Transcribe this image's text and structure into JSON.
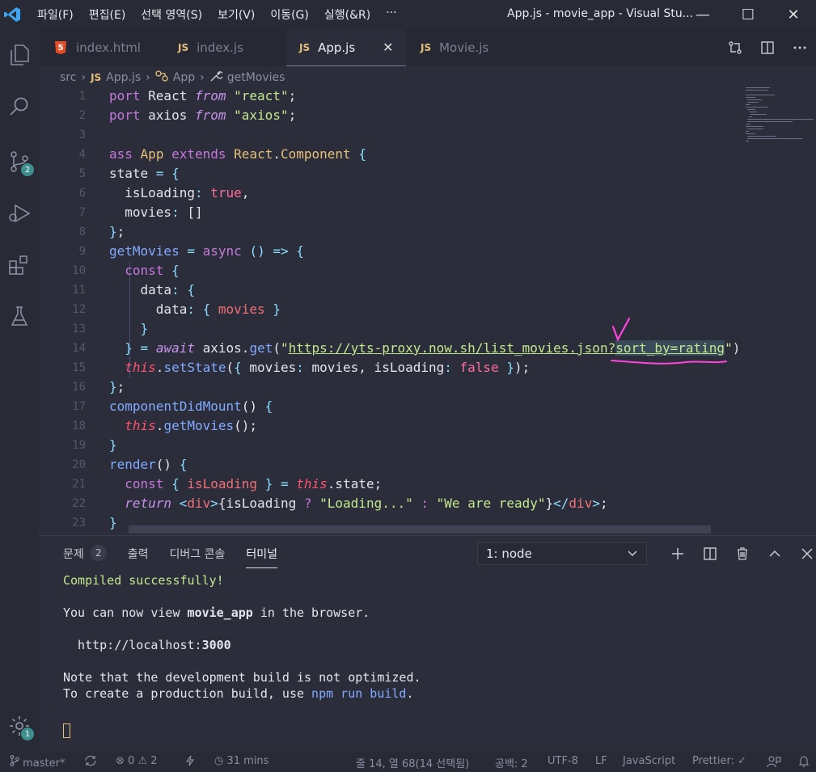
{
  "window": {
    "title": "App.js - movie_app - Visual Stu...",
    "menu": [
      "파일(F)",
      "편집(E)",
      "선택 영역(S)",
      "보기(V)",
      "이동(G)",
      "실행(&R)",
      "···"
    ],
    "controls": {
      "minimize": "—",
      "maximize": "☐",
      "close": "✕"
    }
  },
  "activity_bar": {
    "scm_badge": "2",
    "settings_badge": "1"
  },
  "tabs": [
    {
      "label": "index.html",
      "icon": "html5-icon",
      "icon_text": "5"
    },
    {
      "label": "index.js",
      "icon": "js-icon",
      "icon_text": "JS"
    },
    {
      "label": "App.js",
      "icon": "js-icon",
      "icon_text": "JS",
      "active": true,
      "close": "✕"
    },
    {
      "label": "Movie.js",
      "icon": "js-icon",
      "icon_text": "JS"
    }
  ],
  "breadcrumb": {
    "folder": "src",
    "file_icon": "JS",
    "file": "App.js",
    "class": "App",
    "method": "getMovies"
  },
  "editor": {
    "lines": [
      {
        "n": "1",
        "code": "port React from \"react\";"
      },
      {
        "n": "2",
        "code": "port axios from \"axios\";"
      },
      {
        "n": "3",
        "code": ""
      },
      {
        "n": "4",
        "code": "ass App extends React.Component {"
      },
      {
        "n": "5",
        "code": "state = {"
      },
      {
        "n": "6",
        "code": "  isLoading: true,"
      },
      {
        "n": "7",
        "code": "  movies: []"
      },
      {
        "n": "8",
        "code": "};"
      },
      {
        "n": "9",
        "code": "getMovies = async () => {"
      },
      {
        "n": "10",
        "code": "  const {"
      },
      {
        "n": "11",
        "code": "    data: {"
      },
      {
        "n": "12",
        "code": "      data: { movies }"
      },
      {
        "n": "13",
        "code": "    }"
      },
      {
        "n": "14",
        "code": "  } = await axios.get(\"https://yts-proxy.now.sh/list_movies.json?sort_by=rating\")"
      },
      {
        "n": "15",
        "code": "  this.setState({ movies: movies, isLoading: false });"
      },
      {
        "n": "16",
        "code": "};"
      },
      {
        "n": "17",
        "code": "componentDidMount() {"
      },
      {
        "n": "18",
        "code": "  this.getMovies();"
      },
      {
        "n": "19",
        "code": "}"
      },
      {
        "n": "20",
        "code": "render() {"
      },
      {
        "n": "21",
        "code": "  const { isLoading } = this.state;"
      },
      {
        "n": "22",
        "code": "  return <div>{isLoading ? \"Loading...\" : \"We are ready\"}</div>;"
      },
      {
        "n": "23",
        "code": "}"
      }
    ],
    "annotation": {
      "check": "✓",
      "color": "#ff44dd"
    }
  },
  "panel": {
    "tabs": [
      {
        "label": "문제",
        "count": "2"
      },
      {
        "label": "출력"
      },
      {
        "label": "디버그 콘솔"
      },
      {
        "label": "터미널",
        "active": true
      }
    ],
    "terminal_select": "1: node",
    "terminal": {
      "compiled": "Compiled successfully!",
      "view_prefix": "You can now view ",
      "app_name": "movie_app",
      "view_suffix": " in the browser.",
      "url_prefix": "  http://localhost:",
      "port": "3000",
      "note1": "Note that the development build is not optimized.",
      "note2_prefix": "To create a production build, use ",
      "note2_cmd": "npm run build",
      "note2_suffix": "."
    }
  },
  "statusbar": {
    "branch": "master*",
    "errors": "0",
    "warnings": "2",
    "time": "31 mins",
    "position": "줄 14, 열 68(14 선택됨)",
    "spaces": "공백: 2",
    "encoding": "UTF-8",
    "eol": "LF",
    "language": "JavaScript",
    "prettier": "Prettier: ✓"
  },
  "colors": {
    "background": "#2b2d3a",
    "accent_js": "#e5c07b",
    "string": "#c3e88d",
    "keyword_pink": "#ff6e9a"
  }
}
